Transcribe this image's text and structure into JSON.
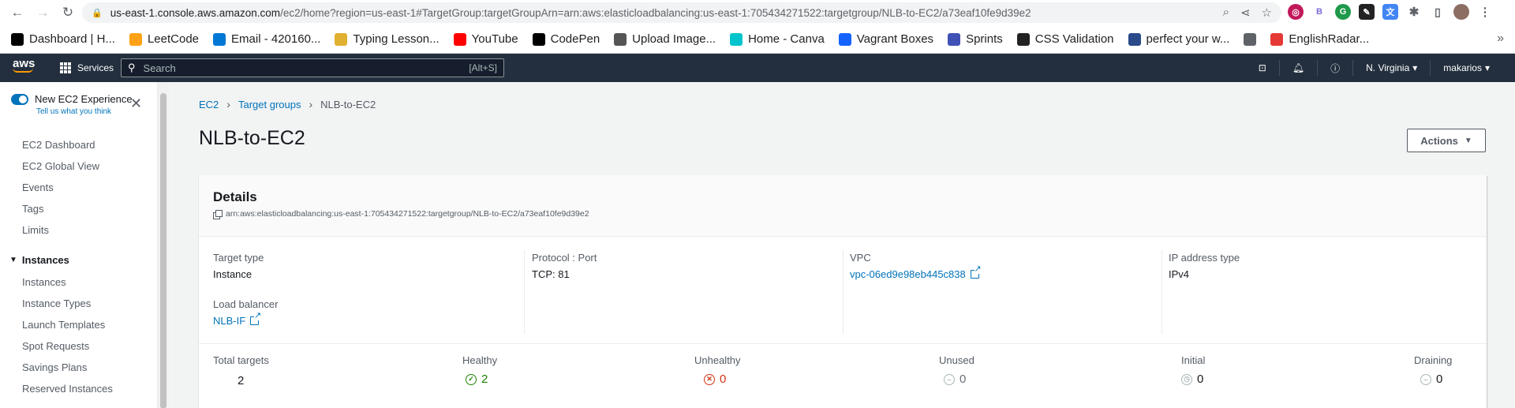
{
  "browser": {
    "url_host": "us-east-1.console.aws.amazon.com",
    "url_path": "/ec2/home?region=us-east-1#TargetGroup:targetGroupArn=arn:aws:elasticloadbalancing:us-east-1:705434271522:targetgroup/NLB-to-EC2/a73eaf10fe9d39e2"
  },
  "bookmarks": [
    {
      "label": "Dashboard | H...",
      "color": "#000000"
    },
    {
      "label": "LeetCode",
      "color": "#ffa116"
    },
    {
      "label": "Email - 420160...",
      "color": "#0078d4"
    },
    {
      "label": "Typing Lesson...",
      "color": "#e0b030"
    },
    {
      "label": "YouTube",
      "color": "#ff0000"
    },
    {
      "label": "CodePen",
      "color": "#000000"
    },
    {
      "label": "Upload Image...",
      "color": "#555555"
    },
    {
      "label": "Home - Canva",
      "color": "#00c4cc"
    },
    {
      "label": "Vagrant Boxes",
      "color": "#1563ff"
    },
    {
      "label": "Sprints",
      "color": "#3f51b5"
    },
    {
      "label": "CSS Validation",
      "color": "#222222"
    },
    {
      "label": "perfect your w...",
      "color": "#2a4a8a"
    },
    {
      "label": "",
      "color": "#5f6368"
    },
    {
      "label": "EnglishRadar...",
      "color": "#e53935"
    }
  ],
  "aws_nav": {
    "logo": "aws",
    "services_label": "Services",
    "search_placeholder": "Search",
    "search_shortcut": "[Alt+S]",
    "region": "N. Virginia",
    "user": "makarios"
  },
  "sidebar": {
    "toggle_label": "New EC2 Experience",
    "feedback": "Tell us what you think",
    "items": [
      "EC2 Dashboard",
      "EC2 Global View",
      "Events",
      "Tags",
      "Limits"
    ],
    "section": "Instances",
    "section_items": [
      "Instances",
      "Instance Types",
      "Launch Templates",
      "Spot Requests",
      "Savings Plans",
      "Reserved Instances"
    ]
  },
  "breadcrumb": [
    "EC2",
    "Target groups",
    "NLB-to-EC2"
  ],
  "page": {
    "title": "NLB-to-EC2",
    "actions_label": "Actions"
  },
  "details": {
    "title": "Details",
    "arn": "arn:aws:elasticloadbalancing:us-east-1:705434271522:targetgroup/NLB-to-EC2/a73eaf10fe9d39e2",
    "target_type_label": "Target type",
    "target_type": "Instance",
    "protocol_label": "Protocol : Port",
    "protocol": "TCP: 81",
    "vpc_label": "VPC",
    "vpc": "vpc-06ed9e98eb445c838",
    "ip_type_label": "IP address type",
    "ip_type": "IPv4",
    "lb_label": "Load balancer",
    "lb": "NLB-IF"
  },
  "stats": {
    "total_label": "Total targets",
    "total": "2",
    "healthy_label": "Healthy",
    "healthy": "2",
    "unhealthy_label": "Unhealthy",
    "unhealthy": "0",
    "unused_label": "Unused",
    "unused": "0",
    "initial_label": "Initial",
    "initial": "0",
    "draining_label": "Draining",
    "draining": "0"
  },
  "colors": {
    "link": "#0073bb",
    "healthy": "#1d8102",
    "unhealthy": "#d13212",
    "neutral": "#687078",
    "nav_bg": "#232f3e"
  }
}
